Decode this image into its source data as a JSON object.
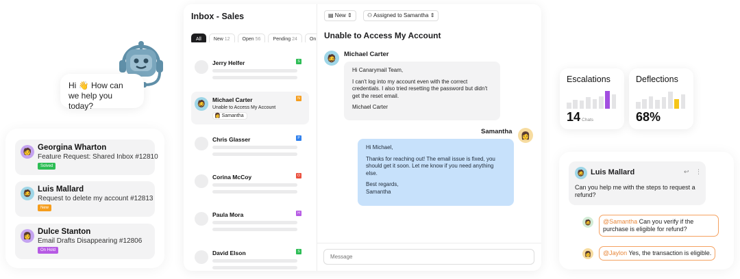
{
  "bot": {
    "greeting": "Hi 👋 How can we help you today?"
  },
  "left_list": [
    {
      "name": "Georgina Wharton",
      "subject": "Feature Request: Shared Inbox #12810",
      "status": "Solved",
      "status_color": "#2dbd55",
      "avatar": "🧑"
    },
    {
      "name": "Luis Mallard",
      "subject": "Request to delete my account #12813",
      "status": "New",
      "status_color": "#f59d1d",
      "avatar": "🧔"
    },
    {
      "name": "Dulce Stanton",
      "subject": "Email Drafts Disappearing #12806",
      "status": "On Hold",
      "status_color": "#b65ae4",
      "avatar": "👩"
    }
  ],
  "inbox": {
    "title": "Inbox - Sales",
    "filters": [
      {
        "label": "All",
        "count": ""
      },
      {
        "label": "New",
        "count": "12"
      },
      {
        "label": "Open",
        "count": "56"
      },
      {
        "label": "Pending",
        "count": "24"
      },
      {
        "label": "On",
        "count": ""
      }
    ],
    "conversations": [
      {
        "name": "Jerry Helfer",
        "badge": "S",
        "badge_color": "#2dbd55"
      },
      {
        "name": "Michael Carter",
        "badge": "N",
        "badge_color": "#f59d1d",
        "subject": "Unable to Access My Account",
        "assignee": "Samantha"
      },
      {
        "name": "Chris Glasser",
        "badge": "P",
        "badge_color": "#2f80ed"
      },
      {
        "name": "Corina McCoy",
        "badge": "O",
        "badge_color": "#eb4f3d"
      },
      {
        "name": "Paula Mora",
        "badge": "H",
        "badge_color": "#b65ae4"
      },
      {
        "name": "David Elson",
        "badge": "S",
        "badge_color": "#2dbd55"
      }
    ]
  },
  "ticket": {
    "status": "New",
    "assigned": "Assigned to Samantha",
    "title": "Unable to Access My Account",
    "customer_name": "Michael Carter",
    "customer_msg": [
      "Hi Canarymail Team,",
      "I can't log into my account even with the correct credentials. I also tried resetting the password but didn't get the reset email.",
      "Michael Carter"
    ],
    "agent_name": "Samantha",
    "agent_msg": [
      "Hi Michael,",
      "Thanks for reaching out! The email issue is fixed, you should get it soon. Let me know if you need anything else.",
      "Best regards,\nSamantha"
    ],
    "composer_placeholder": "Message"
  },
  "stats": {
    "escalations": {
      "title": "Escalations",
      "value": "14",
      "unit": "Chats",
      "bars": [
        0.35,
        0.5,
        0.45,
        0.65,
        0.55,
        0.7,
        1.0,
        0.8
      ],
      "highlight": 6,
      "highlight_color": "#a24fe0"
    },
    "deflections": {
      "title": "Deflections",
      "value": "68%",
      "bars": [
        0.4,
        0.55,
        0.7,
        0.5,
        0.65,
        0.95,
        0.55,
        0.8
      ],
      "highlight": 6,
      "highlight_color": "#f5c518"
    }
  },
  "right_chat": {
    "name": "Luis Mallard",
    "message": "Can you help me with the steps to request a refund?",
    "mentions": [
      {
        "at": "@Samantha",
        "text": " Can you verify if the purchase is eligible for refund?"
      },
      {
        "at": "@Jaylon",
        "text": " Yes, the transaction is eligible."
      }
    ]
  }
}
